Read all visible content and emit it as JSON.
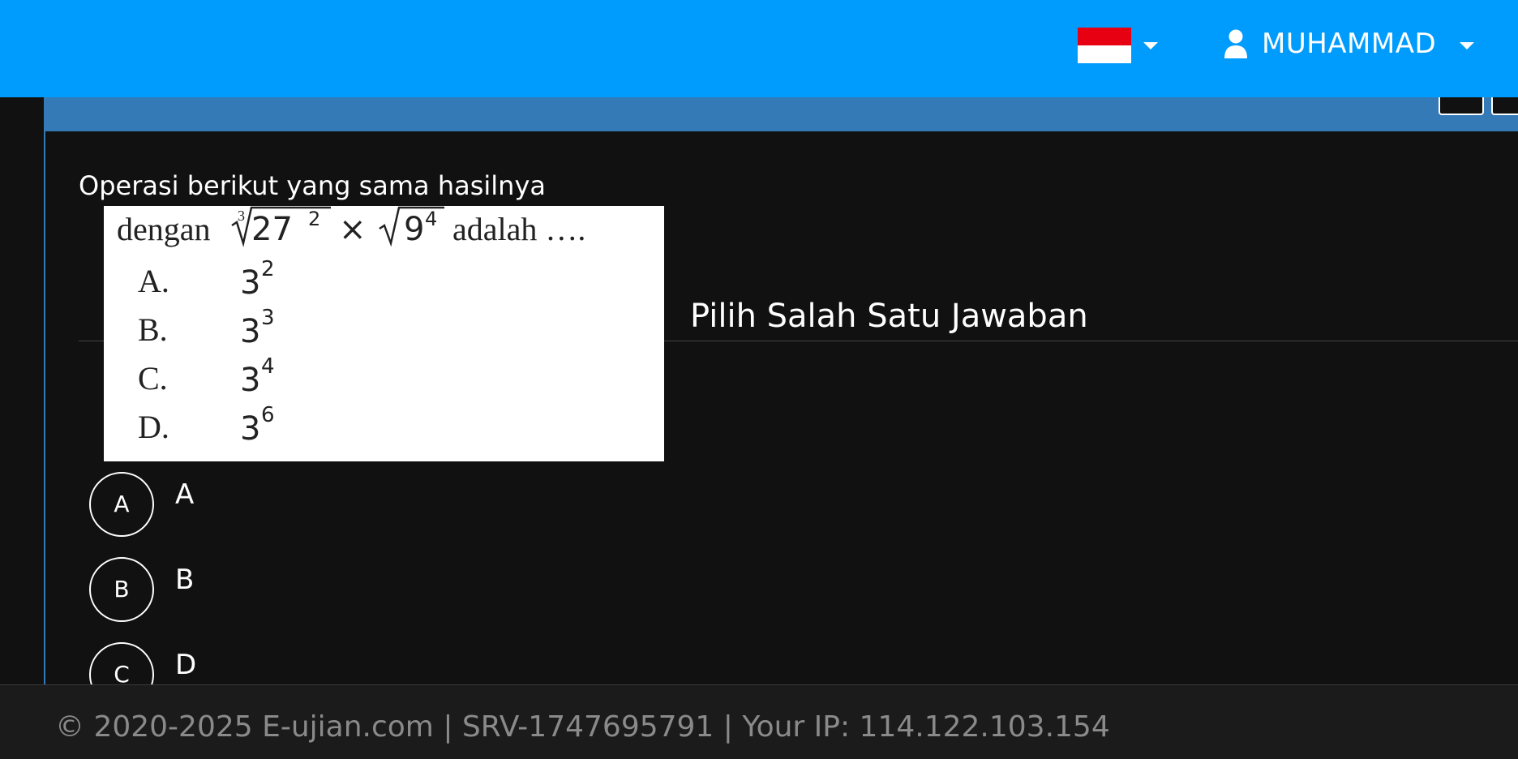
{
  "header": {
    "language_flag": "indonesia-flag",
    "user_icon": "user-icon",
    "user_name": "MUHAMMAD",
    "colors": {
      "navbar": "#009cfd",
      "panel_heading": "#337ab7",
      "flag_red": "#e70011"
    }
  },
  "question": {
    "text": "Operasi berikut yang sama hasilnya",
    "image": {
      "stem_prefix": "dengan",
      "stem_root_index": "3",
      "stem_base1": "27",
      "stem_exp1": "2",
      "stem_times": "×",
      "stem_sqrt": "√",
      "stem_base2": "9",
      "stem_exp2": "4",
      "stem_suffix": "adalah ….",
      "choices": [
        {
          "letter": "A.",
          "base": "3",
          "exp": "2"
        },
        {
          "letter": "B.",
          "base": "3",
          "exp": "3"
        },
        {
          "letter": "C.",
          "base": "3",
          "exp": "4"
        },
        {
          "letter": "D.",
          "base": "3",
          "exp": "6"
        }
      ]
    }
  },
  "answers": {
    "instruction": "Pilih Salah Satu Jawaban",
    "options": [
      {
        "key": "A",
        "text": "A"
      },
      {
        "key": "B",
        "text": "B"
      },
      {
        "key": "C",
        "text": "D"
      }
    ]
  },
  "footer": {
    "text": "© 2020-2025 E-ujian.com | SRV-1747695791 | Your IP: 114.122.103.154"
  }
}
